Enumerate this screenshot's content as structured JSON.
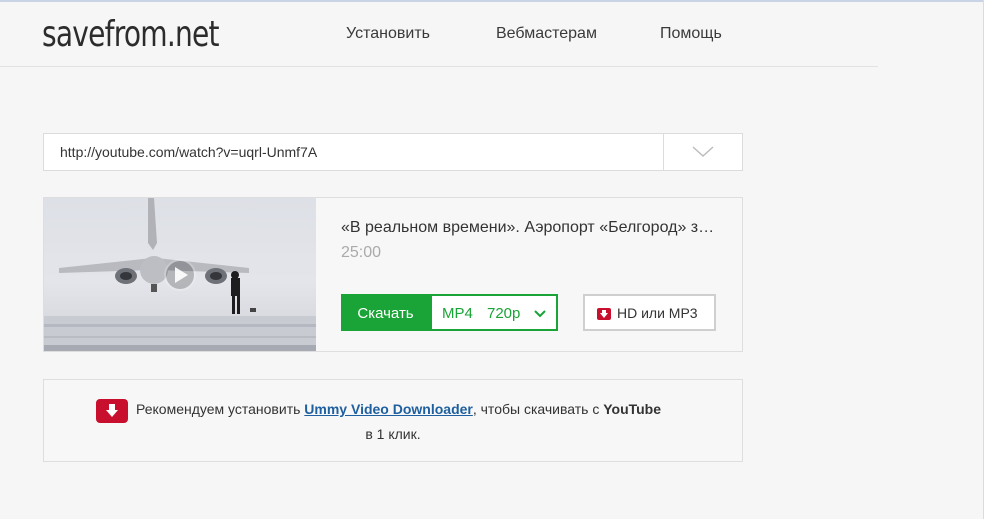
{
  "header": {
    "logo": "savefrom.net",
    "nav": [
      {
        "label": "Установить"
      },
      {
        "label": "Вебмастерам"
      },
      {
        "label": "Помощь"
      }
    ]
  },
  "search": {
    "value": "http://youtube.com/watch?v=uqrl-Unmf7A",
    "dropdown_icon": "chevron-down-icon"
  },
  "result": {
    "title": "«В реальном времени». Аэропорт «Белгород» за полчаса до мощной метели",
    "duration": "25:00",
    "download_label": "Скачать",
    "format": "MP4",
    "quality": "720p",
    "hd_label": "HD или MP3"
  },
  "promo": {
    "text_before": "Рекомендуем установить ",
    "link": "Ummy Video Downloader",
    "text_after": ", чтобы скачивать с ",
    "brand": "YouTube",
    "line2": "в 1 клик."
  },
  "colors": {
    "accent_green": "#1aa336",
    "promo_red": "#c8102e",
    "link_blue": "#1d5f9f"
  }
}
